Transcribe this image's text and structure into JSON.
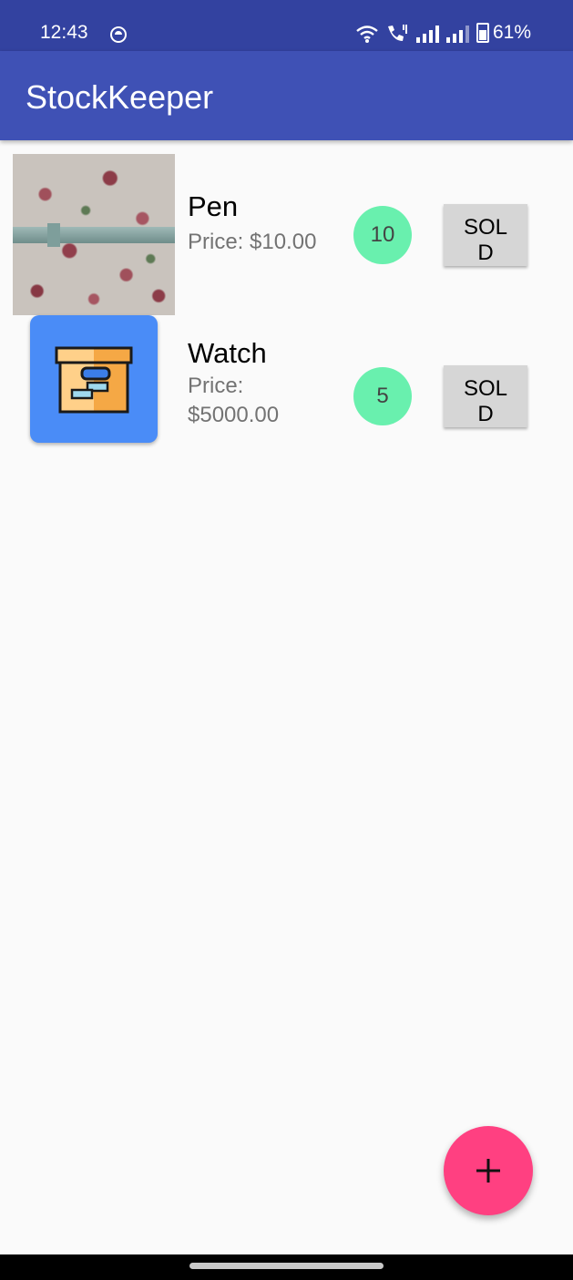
{
  "status_bar": {
    "time": "12:43",
    "battery": "61%",
    "icons": [
      "face-icon",
      "wifi-icon",
      "wifi-call-icon",
      "signal-icon",
      "signal-icon",
      "battery-icon"
    ]
  },
  "app_bar": {
    "title": "StockKeeper"
  },
  "products": [
    {
      "name": "Pen",
      "price": "Price: $10.00",
      "quantity": "10",
      "sold_label": "SOLD",
      "image": "pen-photo"
    },
    {
      "name": "Watch",
      "price": "Price: $5000.00",
      "quantity": "5",
      "sold_label": "SOLD",
      "image": "inventory-box-icon"
    }
  ],
  "fab": {
    "icon": "plus-icon"
  },
  "colors": {
    "status_bar": "#3342a0",
    "app_bar": "#3f51b5",
    "quantity_badge": "#69f0ae",
    "sold_button": "#d6d6d6",
    "fab": "#ff4081",
    "background": "#fafafa"
  }
}
